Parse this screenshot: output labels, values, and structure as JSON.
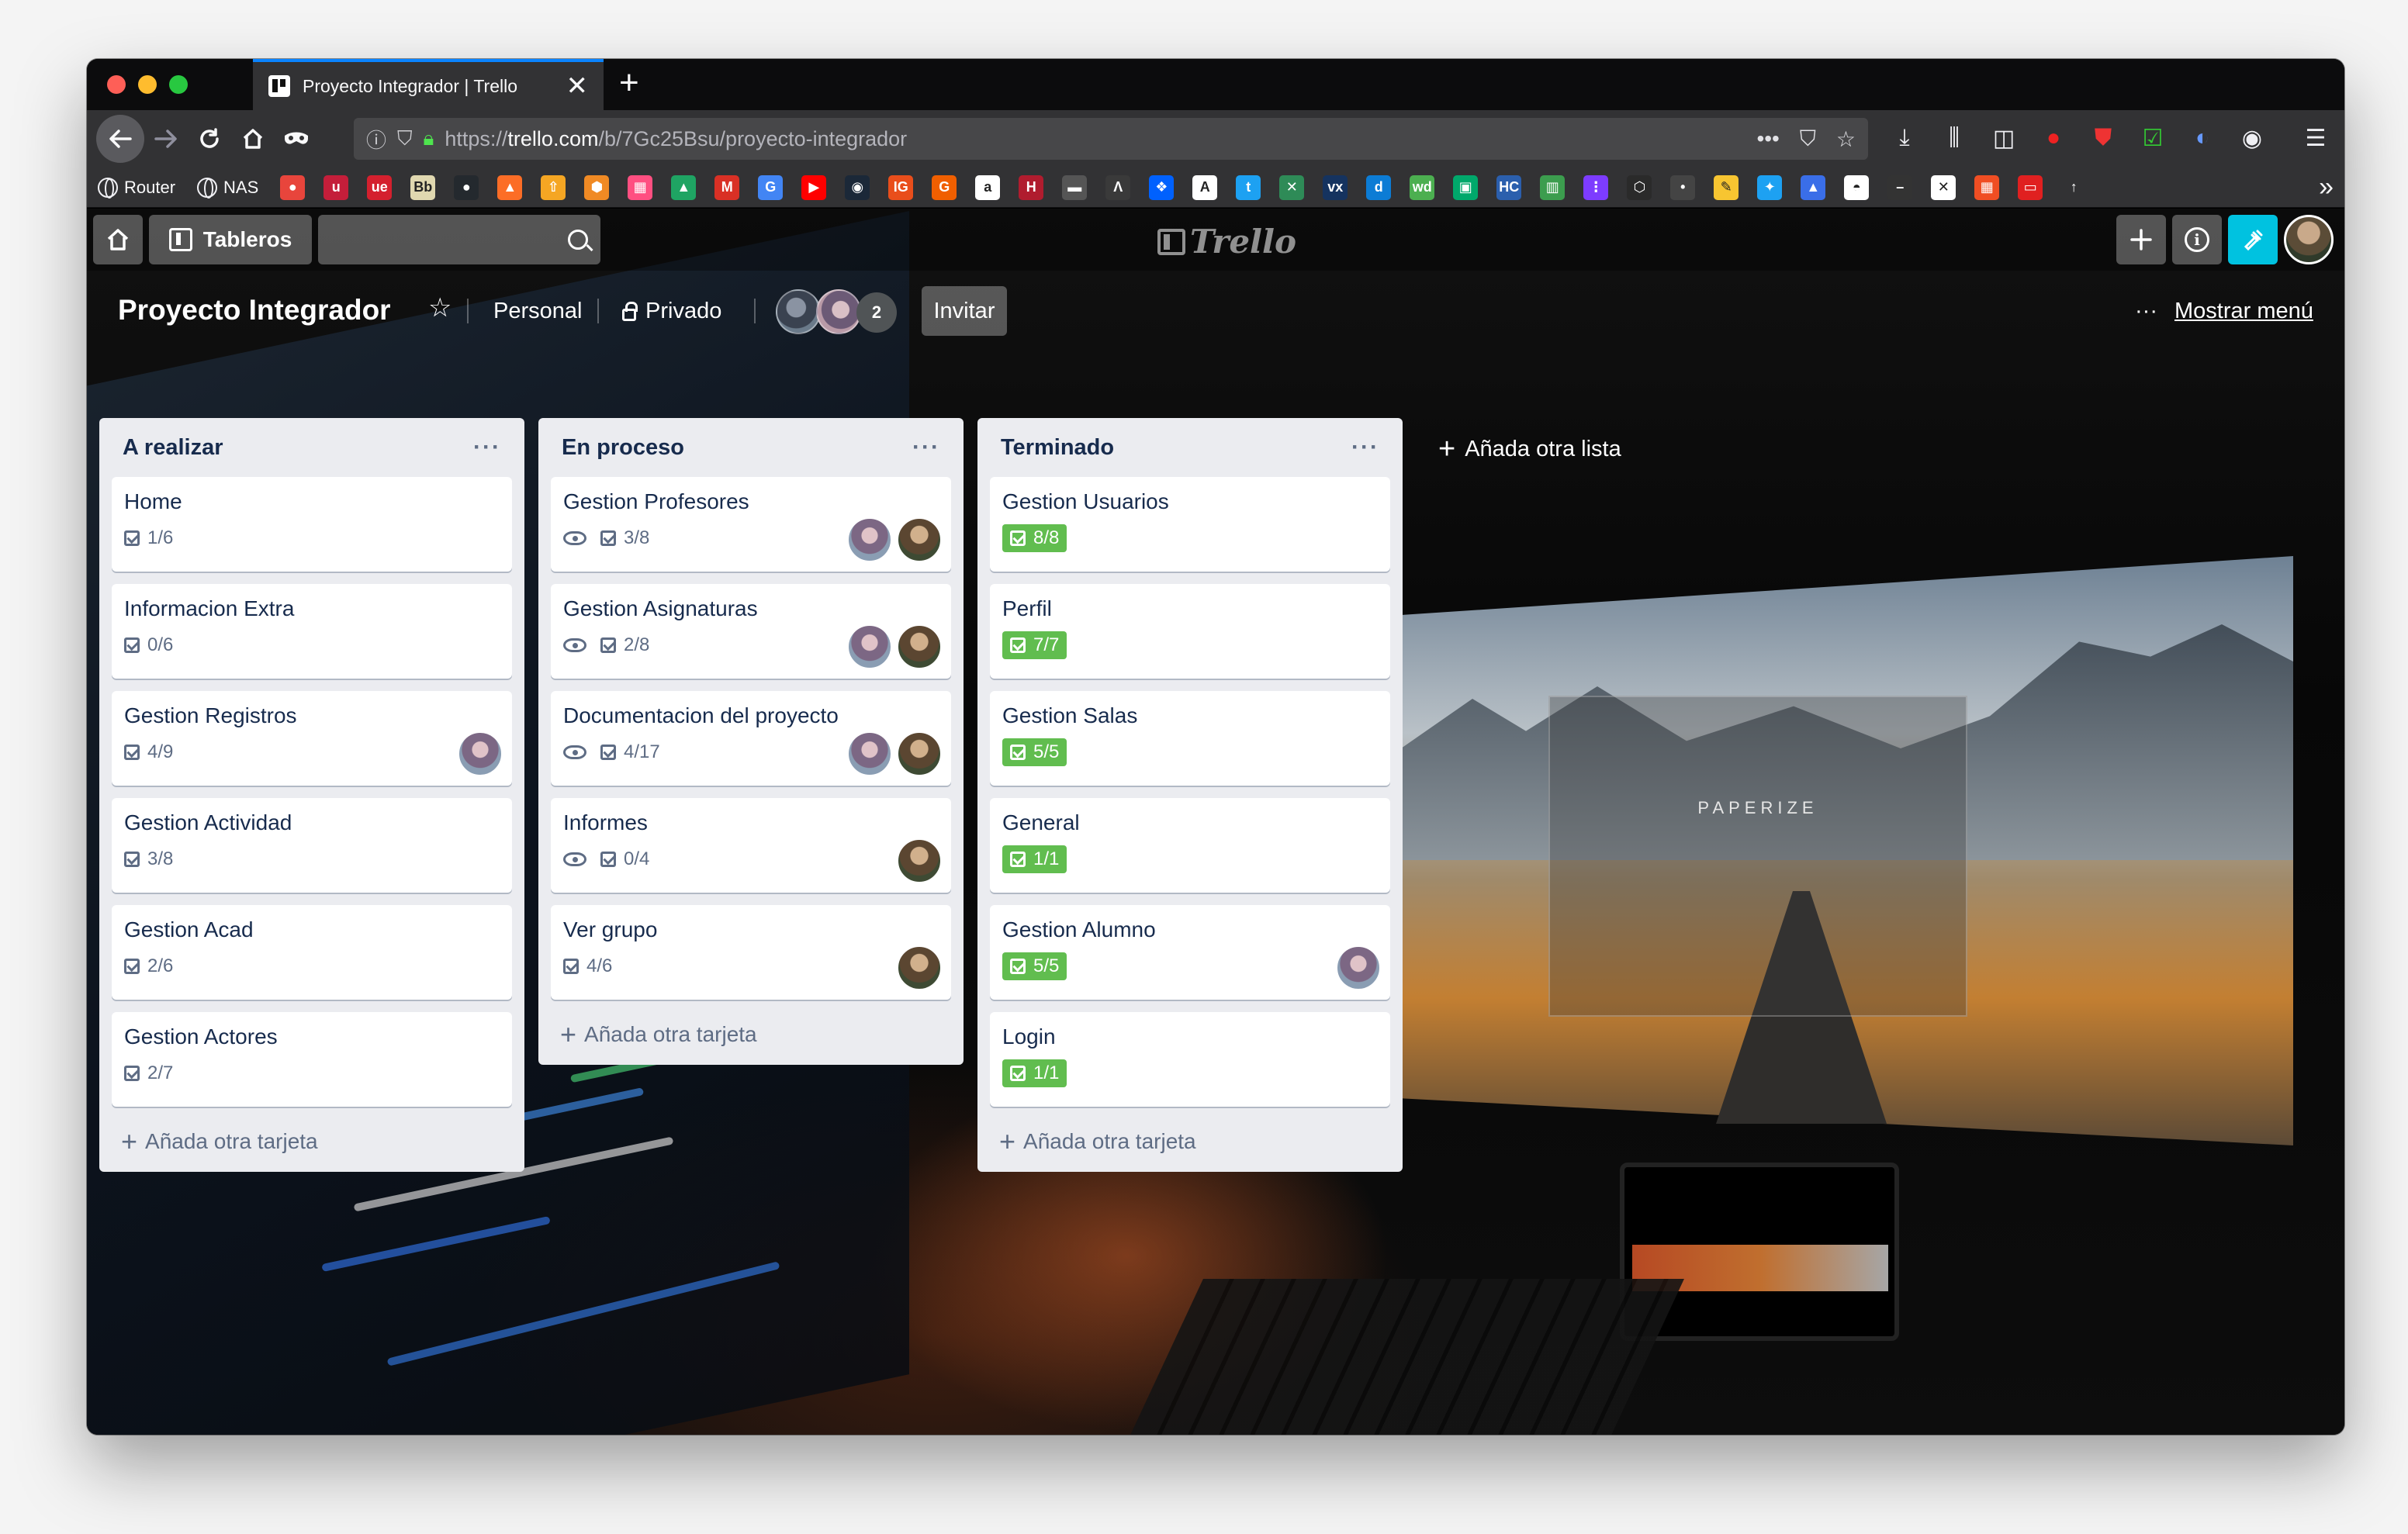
{
  "browser": {
    "tab_title": "Proyecto Integrador | Trello",
    "tab_close": "✕",
    "new_tab": "+",
    "url_prefix": "https://",
    "url_domain": "trello.com",
    "url_path": "/b/7Gc25Bsu/proyecto-integrador",
    "bookmarks_text": [
      {
        "label": "Router"
      },
      {
        "label": "NAS"
      }
    ],
    "bookmark_icons": [
      {
        "name": "chrome-icon",
        "color": "#e8453c",
        "glyph": "●"
      },
      {
        "name": "u-icon",
        "color": "#c41e3a",
        "glyph": "u"
      },
      {
        "name": "ue-icon",
        "color": "#d4202e",
        "glyph": "ue"
      },
      {
        "name": "bb-icon",
        "color": "#e0d8b0",
        "glyph": "Bb"
      },
      {
        "name": "github-icon",
        "color": "#24292e",
        "glyph": "●"
      },
      {
        "name": "gitlab-icon",
        "color": "#fc6d26",
        "glyph": "▲"
      },
      {
        "name": "sourcetree-icon",
        "color": "#f5a623",
        "glyph": "⇧"
      },
      {
        "name": "hex-icon",
        "color": "#f08a24",
        "glyph": "⬢"
      },
      {
        "name": "grid-icon",
        "color": "#ff4f81",
        "glyph": "▦"
      },
      {
        "name": "drive-icon",
        "color": "#1fa463",
        "glyph": "▲"
      },
      {
        "name": "gmail-icon",
        "color": "#d93025",
        "glyph": "M"
      },
      {
        "name": "translate-icon",
        "color": "#4285f4",
        "glyph": "G"
      },
      {
        "name": "youtube-icon",
        "color": "#ff0000",
        "glyph": "▶"
      },
      {
        "name": "steam-icon",
        "color": "#1b2838",
        "glyph": "◉"
      },
      {
        "name": "ig-icon",
        "color": "#e94e1b",
        "glyph": "IG"
      },
      {
        "name": "g2a-icon",
        "color": "#f05f00",
        "glyph": "G"
      },
      {
        "name": "amazon-icon",
        "color": "#ffffff",
        "glyph": "a"
      },
      {
        "name": "h-icon",
        "color": "#b01c2e",
        "glyph": "H"
      },
      {
        "name": "bar-icon",
        "color": "#555555",
        "glyph": "▬"
      },
      {
        "name": "lambda-icon",
        "color": "#3a3a3a",
        "glyph": "Λ"
      },
      {
        "name": "dropbox-icon",
        "color": "#0061fe",
        "glyph": "❖"
      },
      {
        "name": "a-icon",
        "color": "#ffffff",
        "glyph": "A"
      },
      {
        "name": "t-icon",
        "color": "#1da1f2",
        "glyph": "t"
      },
      {
        "name": "x-icon",
        "color": "#2e8b57",
        "glyph": "✕"
      },
      {
        "name": "vx-icon",
        "color": "#15335f",
        "glyph": "vx"
      },
      {
        "name": "d-icon",
        "color": "#0c7cd5",
        "glyph": "d"
      },
      {
        "name": "wd-icon",
        "color": "#4caf50",
        "glyph": "wd"
      },
      {
        "name": "qr-icon",
        "color": "#00a86b",
        "glyph": "▣"
      },
      {
        "name": "hcc-icon",
        "color": "#2b5fad",
        "glyph": "HC"
      },
      {
        "name": "chart-icon",
        "color": "#3c9d4e",
        "glyph": "▥"
      },
      {
        "name": "dots-icon",
        "color": "#7d3cff",
        "glyph": "⋮"
      },
      {
        "name": "hex2-icon",
        "color": "#2a2a2a",
        "glyph": "⬡"
      },
      {
        "name": "dot-icon",
        "color": "#444444",
        "glyph": "•"
      },
      {
        "name": "note-icon",
        "color": "#f7c531",
        "glyph": "✎"
      },
      {
        "name": "twitter-icon",
        "color": "#1da1f2",
        "glyph": "✦"
      },
      {
        "name": "drop-icon",
        "color": "#3a6ee8",
        "glyph": "▲"
      },
      {
        "name": "ghost-icon",
        "color": "#ffffff",
        "glyph": "◓"
      },
      {
        "name": "dash-icon",
        "color": "#333333",
        "glyph": "–"
      },
      {
        "name": "close-bookmark-icon",
        "color": "#ffffff",
        "glyph": "✕"
      },
      {
        "name": "palette-icon",
        "color": "#f04e23",
        "glyph": "▦"
      },
      {
        "name": "record-icon",
        "color": "#e02020",
        "glyph": "▭"
      },
      {
        "name": "arrow-up-icon",
        "color": "#323234",
        "glyph": "↑"
      }
    ],
    "bookmark_overflow": "»"
  },
  "trello": {
    "boards_label": "Tableros",
    "logo_text": "Trello",
    "board_title": "Proyecto Integrador",
    "team_label": "Personal",
    "visibility_label": "Privado",
    "member_count": "2",
    "invite_label": "Invitar",
    "show_menu_label": "Mostrar menú",
    "add_list_label": "Añada otra lista",
    "add_card_label": "Añada otra tarjeta",
    "list_menu": "···"
  },
  "lists": [
    {
      "title": "A realizar",
      "cards": [
        {
          "title": "Home",
          "checklist": "1/6",
          "done": false,
          "watch": false,
          "avatars": []
        },
        {
          "title": "Informacion Extra",
          "checklist": "0/6",
          "done": false,
          "watch": false,
          "avatars": []
        },
        {
          "title": "Gestion Registros",
          "checklist": "4/9",
          "done": false,
          "watch": false,
          "avatars": [
            "a1"
          ]
        },
        {
          "title": "Gestion Actividad",
          "checklist": "3/8",
          "done": false,
          "watch": false,
          "avatars": []
        },
        {
          "title": "Gestion Acad",
          "checklist": "2/6",
          "done": false,
          "watch": false,
          "avatars": []
        },
        {
          "title": "Gestion Actores",
          "checklist": "2/7",
          "done": false,
          "watch": false,
          "avatars": []
        }
      ]
    },
    {
      "title": "En proceso",
      "cards": [
        {
          "title": "Gestion Profesores",
          "checklist": "3/8",
          "done": false,
          "watch": true,
          "avatars": [
            "a1",
            "a2"
          ]
        },
        {
          "title": "Gestion Asignaturas",
          "checklist": "2/8",
          "done": false,
          "watch": true,
          "avatars": [
            "a1",
            "a2"
          ]
        },
        {
          "title": "Documentacion del proyecto",
          "checklist": "4/17",
          "done": false,
          "watch": true,
          "avatars": [
            "a1",
            "a2"
          ]
        },
        {
          "title": "Informes",
          "checklist": "0/4",
          "done": false,
          "watch": true,
          "avatars": [
            "a2"
          ]
        },
        {
          "title": "Ver grupo",
          "checklist": "4/6",
          "done": false,
          "watch": false,
          "avatars": [
            "a2"
          ]
        }
      ]
    },
    {
      "title": "Terminado",
      "cards": [
        {
          "title": "Gestion Usuarios",
          "checklist": "8/8",
          "done": true,
          "watch": false,
          "avatars": []
        },
        {
          "title": "Perfil",
          "checklist": "7/7",
          "done": true,
          "watch": false,
          "avatars": []
        },
        {
          "title": "Gestion Salas",
          "checklist": "5/5",
          "done": true,
          "watch": false,
          "avatars": []
        },
        {
          "title": "General",
          "checklist": "1/1",
          "done": true,
          "watch": false,
          "avatars": []
        },
        {
          "title": "Gestion Alumno",
          "checklist": "5/5",
          "done": true,
          "watch": false,
          "avatars": [
            "a1"
          ]
        },
        {
          "title": "Login",
          "checklist": "1/1",
          "done": true,
          "watch": false,
          "avatars": []
        }
      ]
    }
  ],
  "background": {
    "dialog_text": "PAPERIZE"
  }
}
